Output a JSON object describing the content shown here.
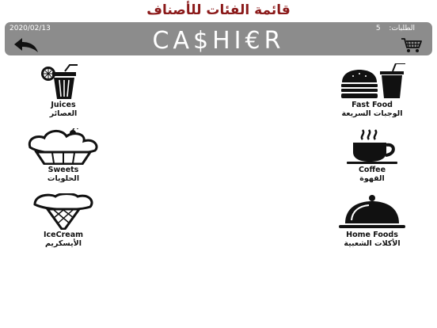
{
  "page_title": "قائمة الفئات للأصناف",
  "header": {
    "date": "2020/02/13",
    "brand": "CA$HI€R",
    "orders_label": "الطلبات:",
    "orders_count": "5",
    "bar_color": "#8c8c8c",
    "title_color": "#8b1a1a"
  },
  "icons": {
    "back": "back-arrow-icon",
    "cart": "shopping-cart-icon"
  },
  "categories": {
    "juices": {
      "en": "Juices",
      "ar": "العصائر",
      "icon": "juice-cup-icon"
    },
    "fast_food": {
      "en": "Fast Food",
      "ar": "الوجبات السريعة",
      "icon": "burger-drink-icon"
    },
    "sweets": {
      "en": "Sweets",
      "ar": "الحلويات",
      "icon": "cupcake-icon"
    },
    "coffee": {
      "en": "Coffee",
      "ar": "القهوة",
      "icon": "coffee-cup-icon"
    },
    "icecream": {
      "en": "IceCream",
      "ar": "الأيسكريم",
      "icon": "ice-cream-cone-icon"
    },
    "home_foods": {
      "en": "Home Foods",
      "ar": "الأكلات الشعبية",
      "icon": "food-cloche-icon"
    }
  }
}
